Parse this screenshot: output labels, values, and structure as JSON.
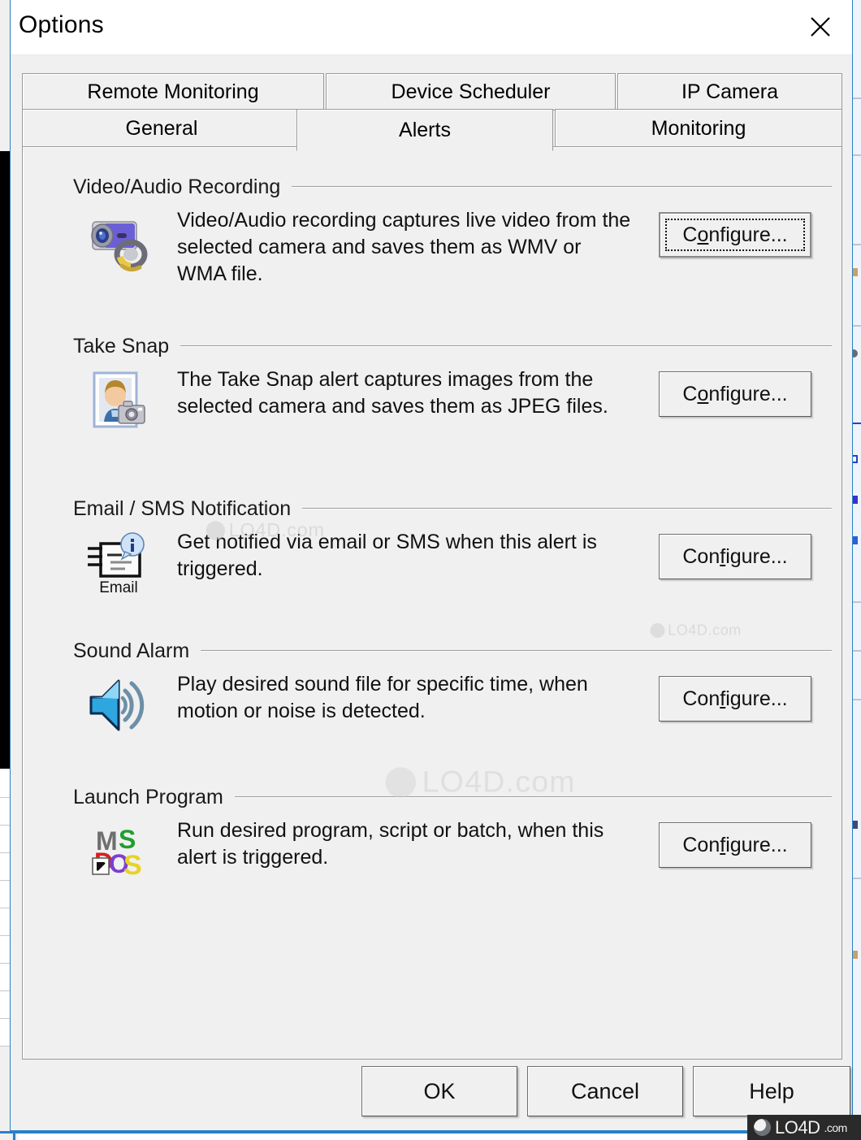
{
  "window": {
    "title": "Options",
    "close_icon": "close-icon"
  },
  "tabs": {
    "row1": [
      {
        "label": "Remote Monitoring",
        "selected": false
      },
      {
        "label": "Device Scheduler",
        "selected": false
      },
      {
        "label": "IP Camera",
        "selected": false
      }
    ],
    "row2": [
      {
        "label": "General",
        "selected": false
      },
      {
        "label": "Alerts",
        "selected": true
      },
      {
        "label": "Monitoring",
        "selected": false
      }
    ]
  },
  "sections": [
    {
      "title": "Video/Audio Recording",
      "icon": "webcam-microphone-icon",
      "description": "Video/Audio recording captures live video from the selected camera and saves them as WMV or WMA file.",
      "button": {
        "label_before": "C",
        "accel": "o",
        "label_after": "nfigure...",
        "focused": true
      }
    },
    {
      "title": "Take Snap",
      "icon": "photo-snapshot-icon",
      "description": "The Take Snap alert captures images from the selected camera and saves them as JPEG files.",
      "button": {
        "label_before": "C",
        "accel": "o",
        "label_after": "nfigure...",
        "focused": false
      }
    },
    {
      "title": "Email / SMS Notification",
      "icon": "email-notification-icon",
      "icon_caption": "Email",
      "description": "Get notified via email or SMS when this alert is triggered.",
      "button": {
        "label_before": "Con",
        "accel": "f",
        "label_after": "igure...",
        "focused": false
      }
    },
    {
      "title": "Sound Alarm",
      "icon": "speaker-sound-icon",
      "description": "Play desired sound file for specific time, when motion or noise is detected.",
      "button": {
        "label_before": "Con",
        "accel": "f",
        "label_after": "igure...",
        "focused": false
      }
    },
    {
      "title": "Launch Program",
      "icon": "ms-dos-program-icon",
      "description": "Run desired program, script or batch, when this alert is triggered.",
      "button": {
        "label_before": "Con",
        "accel": "f",
        "label_after": "igure...",
        "focused": false
      }
    }
  ],
  "footer": {
    "ok_label": "OK",
    "cancel_label": "Cancel",
    "help_label": "Help"
  },
  "watermark": {
    "brand": "LO4D",
    "suffix": ".com",
    "full": "LO4D.com"
  },
  "colors": {
    "window_border": "#2a7fc9",
    "dialog_face": "#f0f0f0",
    "titlebar": "#ffffff",
    "text": "#111111",
    "rule": "#9e9e9e",
    "badge_bg": "#2a2a2a"
  }
}
